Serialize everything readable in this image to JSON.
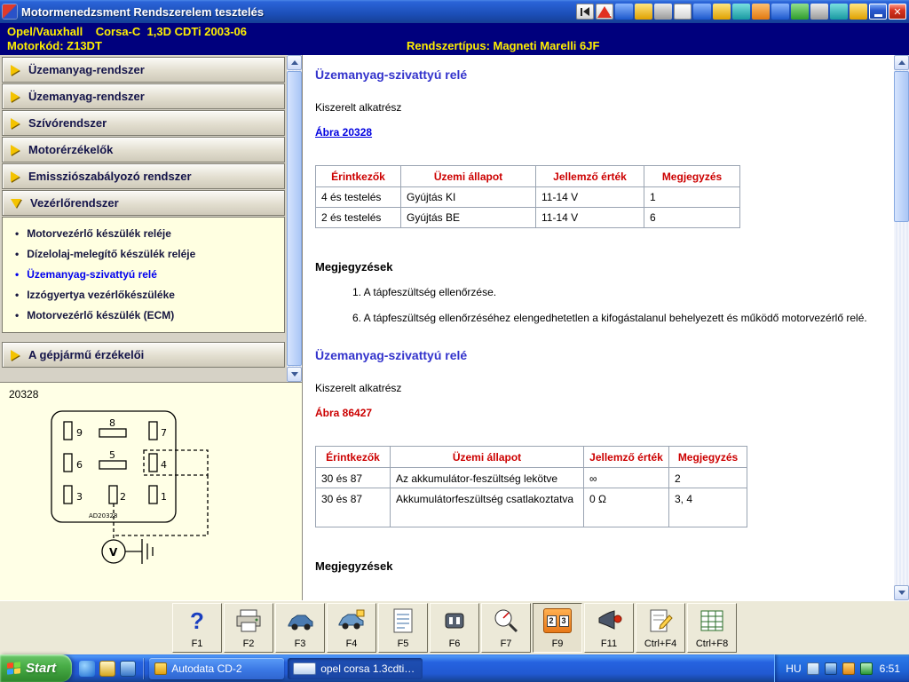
{
  "titlebar": {
    "title": "Motormenedzsment Rendszerelem tesztelés",
    "warning_glyph": "!",
    "close_glyph": "✕"
  },
  "header": {
    "vehicle_line1": "Opel/Vauxhall    Corsa-C  1,3D CDTi 2003-06",
    "vehicle_line2": "Motorkód: Z13DT",
    "system_type": "Rendszertípus: Magneti Marelli 6JF"
  },
  "sidebar": {
    "items": [
      {
        "label": "Üzemanyag-rendszer"
      },
      {
        "label": "Üzemanyag-rendszer"
      },
      {
        "label": "Szívórendszer"
      },
      {
        "label": "Motorérzékelők"
      },
      {
        "label": "Emissziószabályozó rendszer"
      },
      {
        "label": "Vezérlőrendszer"
      }
    ],
    "subitems": [
      {
        "bullet": "•",
        "label": "Motorvezérlő készülék reléje"
      },
      {
        "bullet": "•",
        "label": "Dízelolaj-melegítő készülék reléje"
      },
      {
        "bullet": "•",
        "label": "Üzemanyag-szivattyú relé"
      },
      {
        "bullet": "•",
        "label": "Izzógyertya vezérlőkészüléke"
      },
      {
        "bullet": "•",
        "label": "Motorvezérlő készülék (ECM)"
      }
    ],
    "bottom_item": {
      "label": "A gépjármű érzékelői"
    },
    "diagram": {
      "ref": "20328",
      "drawing_code": "AD20328",
      "pins": [
        "9",
        "8",
        "7",
        "6",
        "5",
        "4",
        "3",
        "2",
        "1"
      ],
      "meter_label": "V"
    }
  },
  "main": {
    "section1": {
      "title": "Üzemanyag-szivattyú relé",
      "subtitle": "Kiszerelt alkatrész",
      "figure_link": "Ábra 20328",
      "table": {
        "headers": [
          "Érintkezők",
          "Üzemi állapot",
          "Jellemző érték",
          "Megjegyzés"
        ],
        "rows": [
          [
            "4 és testelés",
            "Gyújtás KI",
            "11-14 V",
            "1"
          ],
          [
            "2 és testelés",
            "Gyújtás BE",
            "11-14 V",
            "6"
          ]
        ]
      },
      "notes_title": "Megjegyzések",
      "notes": [
        "1. A tápfeszültség ellenőrzése.",
        "6. A tápfeszültség ellenőrzéséhez elengedhetetlen a kifogástalanul behelyezett és működő motorvezérlő relé."
      ]
    },
    "section2": {
      "title": "Üzemanyag-szivattyú relé",
      "subtitle": "Kiszerelt alkatrész",
      "figure_link": "Ábra 86427",
      "table": {
        "headers": [
          "Érintkezők",
          "Üzemi állapot",
          "Jellemző érték",
          "Megjegyzés"
        ],
        "rows": [
          [
            "30 és 87",
            "Az akkumulátor-feszültség lekötve",
            "∞",
            "2"
          ],
          [
            "30 és 87",
            "Akkumulátorfeszültség csatlakoztatva",
            "0 Ω",
            "3, 4"
          ]
        ]
      },
      "notes_title": "Megjegyzések"
    }
  },
  "toolbar": {
    "buttons": [
      {
        "label": "F1",
        "glyph": "?"
      },
      {
        "label": "F2"
      },
      {
        "label": "F3"
      },
      {
        "label": "F4"
      },
      {
        "label": "F5"
      },
      {
        "label": "F6"
      },
      {
        "label": "F7"
      },
      {
        "label": "F9",
        "digits": [
          "2",
          "3"
        ]
      },
      {
        "label": "F11"
      },
      {
        "label": "Ctrl+F4"
      },
      {
        "label": "Ctrl+F8"
      }
    ]
  },
  "taskbar": {
    "start_label": "Start",
    "windows": [
      {
        "title": "Autodata CD-2"
      },
      {
        "title": "opel corsa 1.3cdti - P..."
      }
    ],
    "language": "HU",
    "time": "6:51"
  }
}
